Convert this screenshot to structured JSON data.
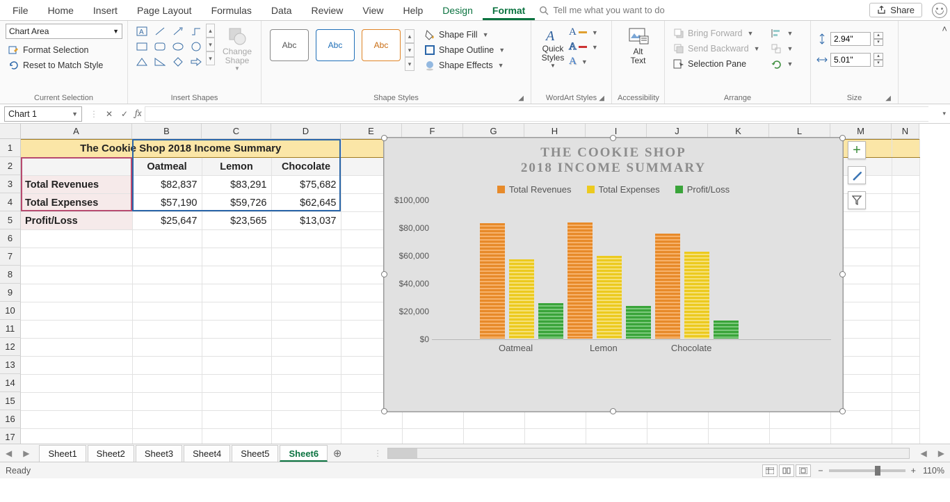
{
  "menu": {
    "tabs": [
      "File",
      "Home",
      "Insert",
      "Page Layout",
      "Formulas",
      "Data",
      "Review",
      "View",
      "Help",
      "Design",
      "Format"
    ],
    "active": "Format",
    "ctx_start": 9,
    "search_placeholder": "Tell me what you want to do",
    "share": "Share"
  },
  "ribbon": {
    "current_selection": {
      "combo": "Chart Area",
      "format_selection": "Format Selection",
      "reset": "Reset to Match Style",
      "label": "Current Selection"
    },
    "insert_shapes": {
      "change_shape": "Change\nShape",
      "label": "Insert Shapes"
    },
    "shape_styles": {
      "cards": [
        "Abc",
        "Abc",
        "Abc"
      ],
      "shape_fill": "Shape Fill",
      "shape_outline": "Shape Outline",
      "shape_effects": "Shape Effects",
      "label": "Shape Styles"
    },
    "wordart": {
      "quick_styles": "Quick\nStyles",
      "label": "WordArt Styles"
    },
    "accessibility": {
      "alt_text": "Alt\nText",
      "label": "Accessibility"
    },
    "arrange": {
      "bring_forward": "Bring Forward",
      "send_backward": "Send Backward",
      "selection_pane": "Selection Pane",
      "label": "Arrange"
    },
    "size": {
      "height": "2.94\"",
      "width": "5.01\"",
      "label": "Size"
    }
  },
  "formula_bar": {
    "name": "Chart 1"
  },
  "columns": [
    {
      "l": "A",
      "w": 160
    },
    {
      "l": "B",
      "w": 100
    },
    {
      "l": "C",
      "w": 100
    },
    {
      "l": "D",
      "w": 100
    },
    {
      "l": "E",
      "w": 88
    },
    {
      "l": "F",
      "w": 88
    },
    {
      "l": "G",
      "w": 88
    },
    {
      "l": "H",
      "w": 88
    },
    {
      "l": "I",
      "w": 88
    },
    {
      "l": "J",
      "w": 88
    },
    {
      "l": "K",
      "w": 88
    },
    {
      "l": "L",
      "w": 88
    },
    {
      "l": "M",
      "w": 88
    },
    {
      "l": "N",
      "w": 40
    }
  ],
  "rows": [
    1,
    2,
    3,
    4,
    5,
    6,
    7,
    8,
    9,
    10,
    11,
    12,
    13,
    14,
    15,
    16,
    17
  ],
  "table": {
    "title": "The Cookie Shop 2018 Income Summary",
    "col_headers": [
      "Oatmeal",
      "Lemon",
      "Chocolate"
    ],
    "row_labels": [
      "Total Revenues",
      "Total Expenses",
      "Profit/Loss"
    ],
    "values": [
      [
        "$82,837",
        "$83,291",
        "$75,682"
      ],
      [
        "$57,190",
        "$59,726",
        "$62,645"
      ],
      [
        "$25,647",
        "$23,565",
        "$13,037"
      ]
    ]
  },
  "chart": {
    "title_l1": "THE COOKIE SHOP",
    "title_l2": "2018 INCOME SUMMARY",
    "legend": [
      "Total Revenues",
      "Total Expenses",
      "Profit/Loss"
    ],
    "yticks": [
      "$100,000",
      "$80,000",
      "$60,000",
      "$40,000",
      "$20,000",
      "$0"
    ]
  },
  "chart_data": {
    "type": "bar",
    "title": "The Cookie Shop 2018 Income Summary",
    "categories": [
      "Oatmeal",
      "Lemon",
      "Chocolate"
    ],
    "series": [
      {
        "name": "Total Revenues",
        "values": [
          82837,
          83291,
          75682
        ],
        "color": "#e78a2a"
      },
      {
        "name": "Total Expenses",
        "values": [
          57190,
          59726,
          62645
        ],
        "color": "#ecca1f"
      },
      {
        "name": "Profit/Loss",
        "values": [
          25647,
          23565,
          13037
        ],
        "color": "#3aa43a"
      }
    ],
    "ylabel": "",
    "xlabel": "",
    "ylim": [
      0,
      100000
    ]
  },
  "sheets": {
    "tabs": [
      "Sheet1",
      "Sheet2",
      "Sheet3",
      "Sheet4",
      "Sheet5",
      "Sheet6"
    ],
    "active": "Sheet6"
  },
  "status": {
    "ready": "Ready",
    "zoom": "110%"
  }
}
